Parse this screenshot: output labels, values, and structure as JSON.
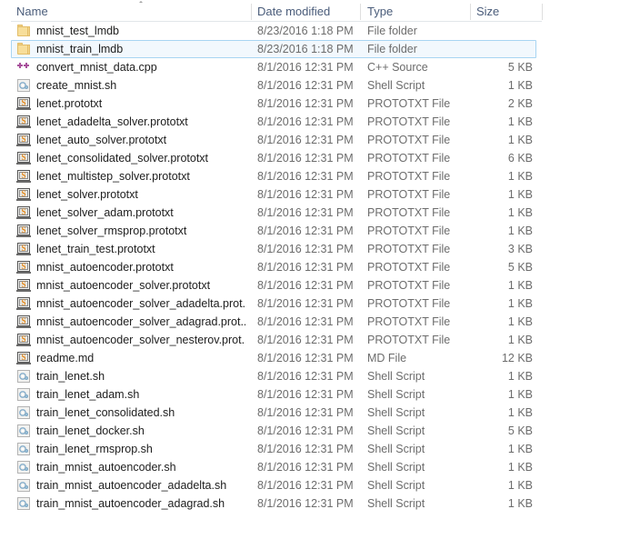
{
  "window": {
    "app": "File Explorer",
    "view": "details-list"
  },
  "columns": [
    {
      "key": "name",
      "label": "Name",
      "sort": "ascending"
    },
    {
      "key": "date",
      "label": "Date modified",
      "sort": "none"
    },
    {
      "key": "type",
      "label": "Type",
      "sort": "none"
    },
    {
      "key": "size",
      "label": "Size",
      "sort": "none"
    }
  ],
  "colors": {
    "header_text": "#4a5c7a",
    "row_text": "#202020",
    "secondary_text": "#6c6c6c",
    "selection_fill": "#f2f8fd",
    "selection_border": "#a8d5f2",
    "folder_icon": "#f7de9a",
    "cpp_icon": "#a8519c",
    "prototxt_glyph": "#e58b20"
  },
  "rows": [
    {
      "name": "mnist_test_lmdb",
      "date": "8/23/2016 1:18 PM",
      "type": "File folder",
      "size": "",
      "icon": "folder-icon",
      "selected": false
    },
    {
      "name": "mnist_train_lmdb",
      "date": "8/23/2016 1:18 PM",
      "type": "File folder",
      "size": "",
      "icon": "folder-icon",
      "selected": true
    },
    {
      "name": "convert_mnist_data.cpp",
      "date": "8/1/2016 12:31 PM",
      "type": "C++ Source",
      "size": "5 KB",
      "icon": "cpp-source-icon",
      "selected": false
    },
    {
      "name": "create_mnist.sh",
      "date": "8/1/2016 12:31 PM",
      "type": "Shell Script",
      "size": "1 KB",
      "icon": "shell-script-icon",
      "selected": false
    },
    {
      "name": "lenet.prototxt",
      "date": "8/1/2016 12:31 PM",
      "type": "PROTOTXT File",
      "size": "2 KB",
      "icon": "prototxt-file-icon",
      "selected": false
    },
    {
      "name": "lenet_adadelta_solver.prototxt",
      "date": "8/1/2016 12:31 PM",
      "type": "PROTOTXT File",
      "size": "1 KB",
      "icon": "prototxt-file-icon",
      "selected": false
    },
    {
      "name": "lenet_auto_solver.prototxt",
      "date": "8/1/2016 12:31 PM",
      "type": "PROTOTXT File",
      "size": "1 KB",
      "icon": "prototxt-file-icon",
      "selected": false
    },
    {
      "name": "lenet_consolidated_solver.prototxt",
      "date": "8/1/2016 12:31 PM",
      "type": "PROTOTXT File",
      "size": "6 KB",
      "icon": "prototxt-file-icon",
      "selected": false
    },
    {
      "name": "lenet_multistep_solver.prototxt",
      "date": "8/1/2016 12:31 PM",
      "type": "PROTOTXT File",
      "size": "1 KB",
      "icon": "prototxt-file-icon",
      "selected": false
    },
    {
      "name": "lenet_solver.prototxt",
      "date": "8/1/2016 12:31 PM",
      "type": "PROTOTXT File",
      "size": "1 KB",
      "icon": "prototxt-file-icon",
      "selected": false
    },
    {
      "name": "lenet_solver_adam.prototxt",
      "date": "8/1/2016 12:31 PM",
      "type": "PROTOTXT File",
      "size": "1 KB",
      "icon": "prototxt-file-icon",
      "selected": false
    },
    {
      "name": "lenet_solver_rmsprop.prototxt",
      "date": "8/1/2016 12:31 PM",
      "type": "PROTOTXT File",
      "size": "1 KB",
      "icon": "prototxt-file-icon",
      "selected": false
    },
    {
      "name": "lenet_train_test.prototxt",
      "date": "8/1/2016 12:31 PM",
      "type": "PROTOTXT File",
      "size": "3 KB",
      "icon": "prototxt-file-icon",
      "selected": false
    },
    {
      "name": "mnist_autoencoder.prototxt",
      "date": "8/1/2016 12:31 PM",
      "type": "PROTOTXT File",
      "size": "5 KB",
      "icon": "prototxt-file-icon",
      "selected": false
    },
    {
      "name": "mnist_autoencoder_solver.prototxt",
      "date": "8/1/2016 12:31 PM",
      "type": "PROTOTXT File",
      "size": "1 KB",
      "icon": "prototxt-file-icon",
      "selected": false
    },
    {
      "name": "mnist_autoencoder_solver_adadelta.prot...",
      "date": "8/1/2016 12:31 PM",
      "type": "PROTOTXT File",
      "size": "1 KB",
      "icon": "prototxt-file-icon",
      "selected": false
    },
    {
      "name": "mnist_autoencoder_solver_adagrad.prot...",
      "date": "8/1/2016 12:31 PM",
      "type": "PROTOTXT File",
      "size": "1 KB",
      "icon": "prototxt-file-icon",
      "selected": false
    },
    {
      "name": "mnist_autoencoder_solver_nesterov.prot...",
      "date": "8/1/2016 12:31 PM",
      "type": "PROTOTXT File",
      "size": "1 KB",
      "icon": "prototxt-file-icon",
      "selected": false
    },
    {
      "name": "readme.md",
      "date": "8/1/2016 12:31 PM",
      "type": "MD File",
      "size": "12 KB",
      "icon": "md-file-icon",
      "selected": false
    },
    {
      "name": "train_lenet.sh",
      "date": "8/1/2016 12:31 PM",
      "type": "Shell Script",
      "size": "1 KB",
      "icon": "shell-script-icon",
      "selected": false
    },
    {
      "name": "train_lenet_adam.sh",
      "date": "8/1/2016 12:31 PM",
      "type": "Shell Script",
      "size": "1 KB",
      "icon": "shell-script-icon",
      "selected": false
    },
    {
      "name": "train_lenet_consolidated.sh",
      "date": "8/1/2016 12:31 PM",
      "type": "Shell Script",
      "size": "1 KB",
      "icon": "shell-script-icon",
      "selected": false
    },
    {
      "name": "train_lenet_docker.sh",
      "date": "8/1/2016 12:31 PM",
      "type": "Shell Script",
      "size": "5 KB",
      "icon": "shell-script-icon",
      "selected": false
    },
    {
      "name": "train_lenet_rmsprop.sh",
      "date": "8/1/2016 12:31 PM",
      "type": "Shell Script",
      "size": "1 KB",
      "icon": "shell-script-icon",
      "selected": false
    },
    {
      "name": "train_mnist_autoencoder.sh",
      "date": "8/1/2016 12:31 PM",
      "type": "Shell Script",
      "size": "1 KB",
      "icon": "shell-script-icon",
      "selected": false
    },
    {
      "name": "train_mnist_autoencoder_adadelta.sh",
      "date": "8/1/2016 12:31 PM",
      "type": "Shell Script",
      "size": "1 KB",
      "icon": "shell-script-icon",
      "selected": false
    },
    {
      "name": "train_mnist_autoencoder_adagrad.sh",
      "date": "8/1/2016 12:31 PM",
      "type": "Shell Script",
      "size": "1 KB",
      "icon": "shell-script-icon",
      "selected": false
    }
  ]
}
